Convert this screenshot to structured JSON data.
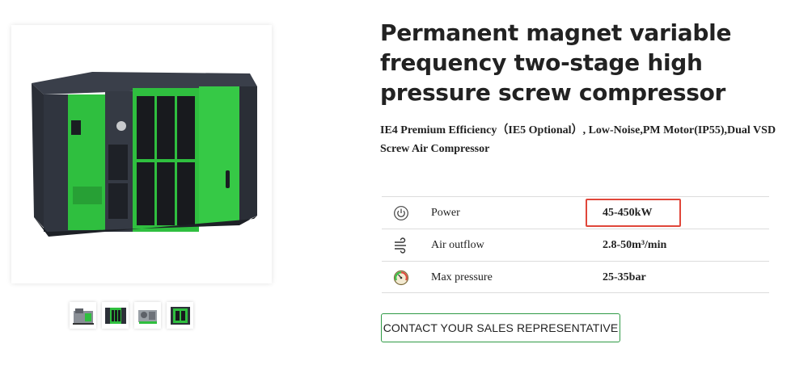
{
  "product": {
    "title": "Permanent magnet variable frequency two-stage high pressure screw compressor",
    "subtitle": "IE4 Premium Efficiency（IE5 Optional）, Low-Noise,PM Motor(IP55),Dual VSD Screw Air Compressor",
    "main_image_icon": "compressor-image",
    "brand_colors": {
      "green": "#2fbf3f",
      "dark": "#2c3038"
    }
  },
  "thumbnails": [
    {
      "icon": "compressor-thumbnail-1"
    },
    {
      "icon": "compressor-thumbnail-2"
    },
    {
      "icon": "compressor-thumbnail-3"
    },
    {
      "icon": "compressor-thumbnail-4"
    }
  ],
  "specs": [
    {
      "icon": "power-icon",
      "label": "Power",
      "value": "45-450kW",
      "highlighted": true
    },
    {
      "icon": "airflow-icon",
      "label": "Air outflow",
      "value": "2.8-50m³/min"
    },
    {
      "icon": "pressure-gauge-icon",
      "label": "Max pressure",
      "value": "25-35bar"
    }
  ],
  "cta": {
    "label": "CONTACT YOUR SALES REPRESENTATIVE",
    "border_color": "#2f9a45"
  },
  "highlight_color": "#e0463a"
}
